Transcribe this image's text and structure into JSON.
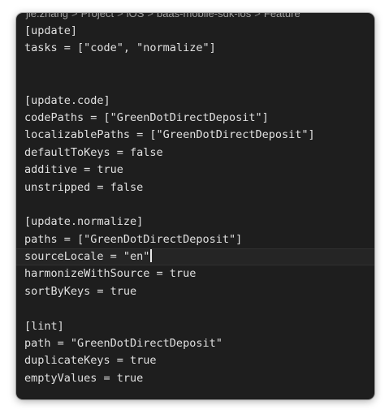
{
  "breadcrumb": [
    "jie.zhang",
    "Project",
    "iOS",
    "baas-mobile-sdk-ios",
    "Feature"
  ],
  "editor": {
    "lines": [
      "[update]",
      "tasks = [\"code\", \"normalize\"]",
      "",
      "",
      "[update.code]",
      "codePaths = [\"GreenDotDirectDeposit\"]",
      "localizablePaths = [\"GreenDotDirectDeposit\"]",
      "defaultToKeys = false",
      "additive = true",
      "unstripped = false",
      "",
      "[update.normalize]",
      "paths = [\"GreenDotDirectDeposit\"]",
      "sourceLocale = \"en\"",
      "harmonizeWithSource = true",
      "sortByKeys = true",
      "",
      "[lint]",
      "path = \"GreenDotDirectDeposit\"",
      "duplicateKeys = true",
      "emptyValues = true"
    ],
    "cursor_line": 14
  },
  "colors": {
    "editor_background": "#1e1e1e",
    "text": "#e0e0e0",
    "breadcrumb_text": "#a0a0a0"
  }
}
